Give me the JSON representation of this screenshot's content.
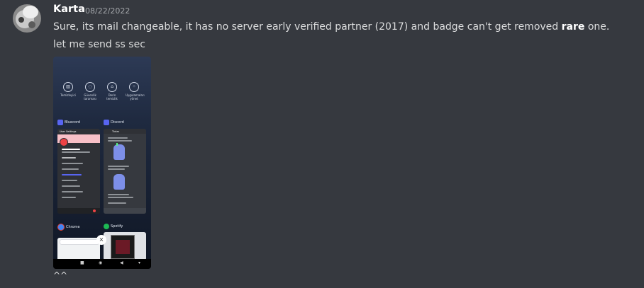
{
  "message": {
    "author": "Karta",
    "timestamp": "08/22/2022",
    "line1_before": "Sure, its mail changeable, it has no server early verified partner (2017) and badge can't get removed ",
    "line1_bold": "rare",
    "line1_after": " one.",
    "line2": "let me send ss sec",
    "line3": "^^"
  },
  "attachment": {
    "quick_settings": [
      {
        "icon": "trash-icon",
        "label": "Temizleyici"
      },
      {
        "icon": "shield-icon",
        "label": "Güvenlik taraması"
      },
      {
        "icon": "home-icon",
        "label": "Derin temizlik"
      },
      {
        "icon": "apps-icon",
        "label": "Uygulamaları yönet"
      }
    ],
    "apps": [
      {
        "name": "Bluecord",
        "icon": "discord-icon",
        "color": "#5865f2"
      },
      {
        "name": "Discord",
        "icon": "discord-icon",
        "color": "#5865f2"
      },
      {
        "name": "Chrome",
        "icon": "chrome-icon",
        "color": "#4285f4"
      },
      {
        "name": "Spotify",
        "icon": "spotify-icon",
        "color": "#1db954"
      }
    ],
    "settings_title": "User Settings",
    "channel_name": "Tixtar",
    "close_symbol": "×"
  },
  "colors": {
    "background": "#36393f",
    "username": "#ffffff",
    "text": "#dcddde",
    "timestamp": "#a3a6aa"
  }
}
